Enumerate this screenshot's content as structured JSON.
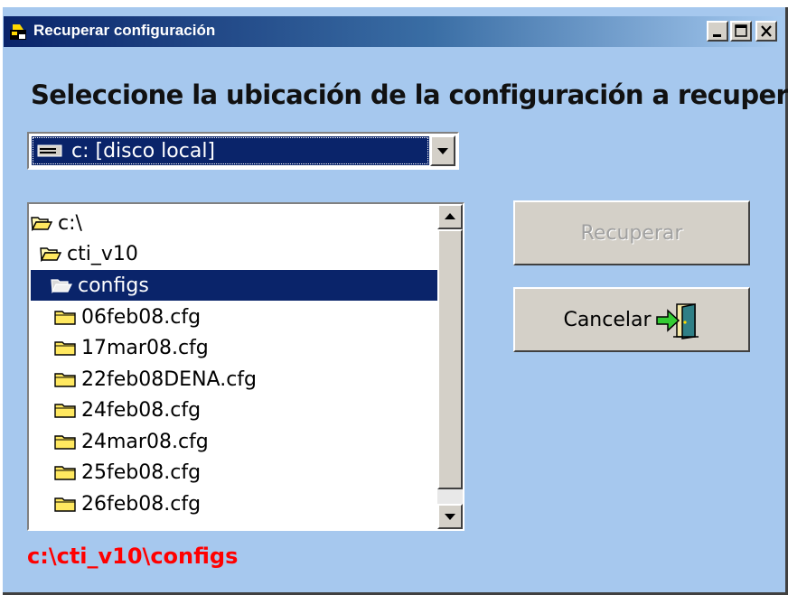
{
  "window": {
    "title": "Recuperar configuración",
    "minimize_label": "_",
    "maximize_label": "□",
    "close_label": "×"
  },
  "heading": "Seleccione la ubicación de la configuración a recuperar",
  "drive": {
    "selected": "c: [disco local]",
    "icon": "drive-icon"
  },
  "directory_list": {
    "items": [
      {
        "label": "c:\\",
        "icon": "open-folder-icon",
        "selected": false
      },
      {
        "label": "cti_v10",
        "icon": "open-folder-icon",
        "selected": false
      },
      {
        "label": "configs",
        "icon": "open-folder-icon",
        "selected": true
      },
      {
        "label": "06feb08.cfg",
        "icon": "folder-icon",
        "selected": false
      },
      {
        "label": "17mar08.cfg",
        "icon": "folder-icon",
        "selected": false
      },
      {
        "label": "22feb08DENA.cfg",
        "icon": "folder-icon",
        "selected": false
      },
      {
        "label": "24feb08.cfg",
        "icon": "folder-icon",
        "selected": false
      },
      {
        "label": "24mar08.cfg",
        "icon": "folder-icon",
        "selected": false
      },
      {
        "label": "25feb08.cfg",
        "icon": "folder-icon",
        "selected": false
      },
      {
        "label": "26feb08.cfg",
        "icon": "folder-icon",
        "selected": false
      }
    ]
  },
  "buttons": {
    "recuperar_label": "Recuperar",
    "recuperar_enabled": false,
    "cancelar_label": "Cancelar"
  },
  "current_path": "c:\\cti_v10\\configs",
  "colors": {
    "background": "#a6c8ee",
    "selection": "#0a246a",
    "path_text": "#ff0000"
  }
}
